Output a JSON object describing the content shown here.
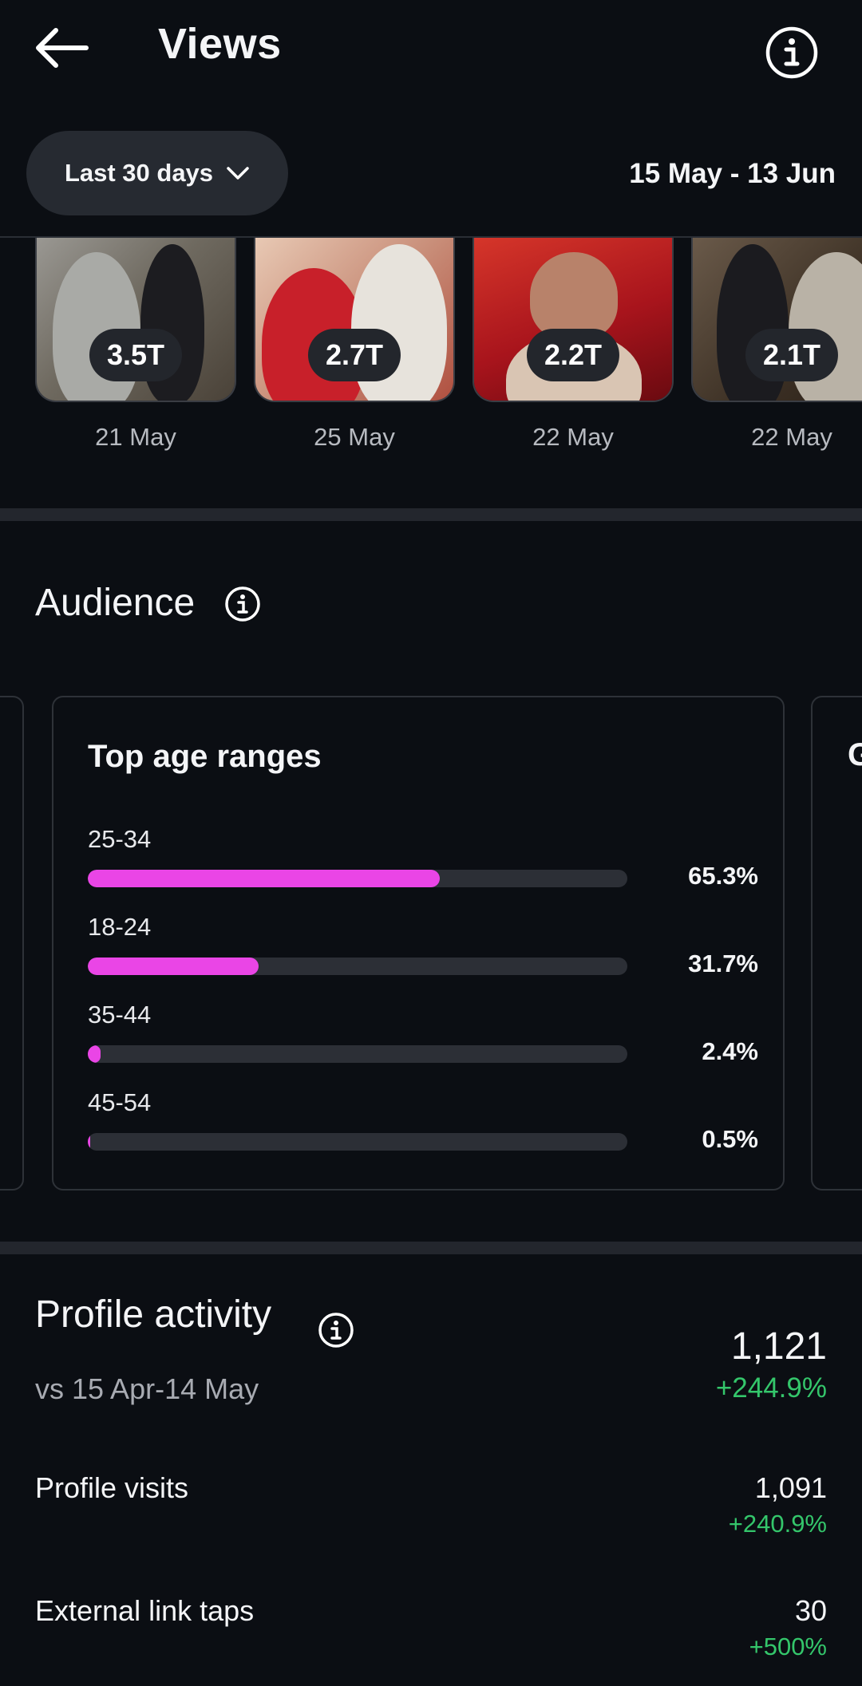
{
  "header": {
    "title": "Views"
  },
  "filter": {
    "period_label": "Last 30 days",
    "date_range": "15 May - 13 Jun"
  },
  "posts": [
    {
      "views": "3.5T",
      "date": "21 May"
    },
    {
      "views": "2.7T",
      "date": "25 May"
    },
    {
      "views": "2.2T",
      "date": "22 May"
    },
    {
      "views": "2.1T",
      "date": "22 May"
    }
  ],
  "audience": {
    "title": "Audience",
    "card_title": "Top age ranges",
    "next_card_initial": "G",
    "age_ranges": [
      {
        "label": "25-34",
        "percent_text": "65.3%",
        "percent": 65.3
      },
      {
        "label": "18-24",
        "percent_text": "31.7%",
        "percent": 31.7
      },
      {
        "label": "35-44",
        "percent_text": "2.4%",
        "percent": 2.4
      },
      {
        "label": "45-54",
        "percent_text": "0.5%",
        "percent": 0.5
      }
    ]
  },
  "profile_activity": {
    "title": "Profile activity",
    "compare": "vs 15 Apr-14 May",
    "total": "1,121",
    "total_change": "+244.9%",
    "metrics": [
      {
        "label": "Profile visits",
        "value": "1,091",
        "change": "+240.9%"
      },
      {
        "label": "External link taps",
        "value": "30",
        "change": "+500%"
      }
    ]
  },
  "colors": {
    "accent_bar": "#ea45e6",
    "positive": "#34c66b",
    "background": "#0b0e13"
  }
}
